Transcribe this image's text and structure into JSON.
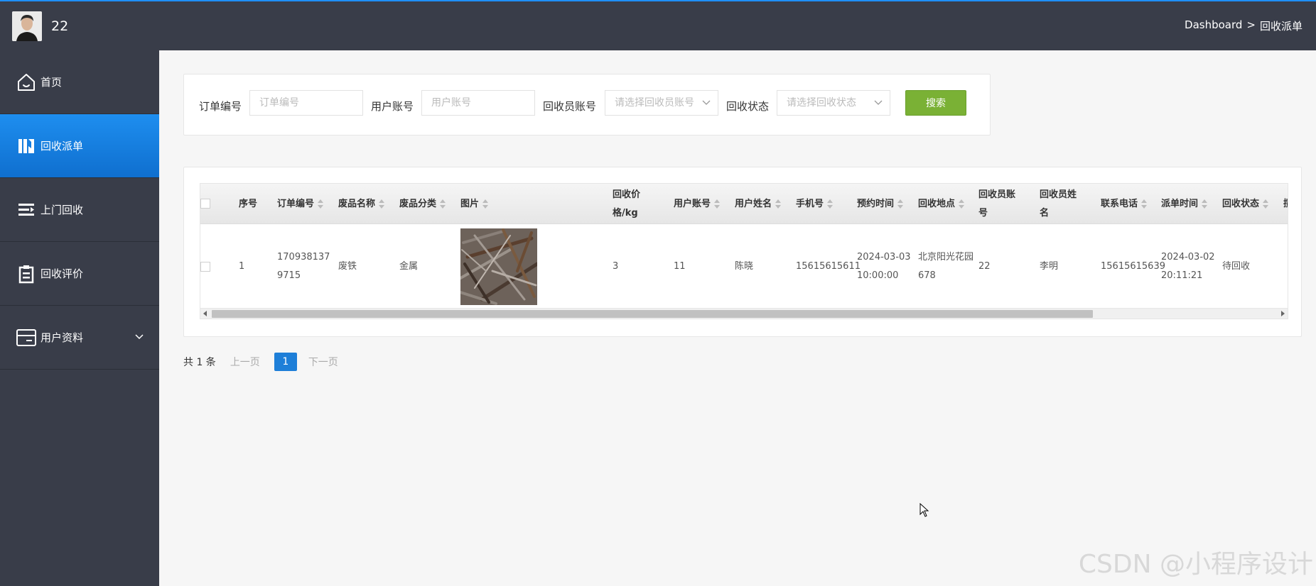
{
  "header": {
    "username": "22",
    "breadcrumb": [
      "Dashboard",
      ">",
      "回收派单"
    ]
  },
  "sidebar": {
    "items": [
      {
        "label": "首页",
        "icon": "home-icon"
      },
      {
        "label": "回收派单",
        "icon": "dispatch-icon",
        "active": true
      },
      {
        "label": "上门回收",
        "icon": "list-icon"
      },
      {
        "label": "回收评价",
        "icon": "clipboard-icon"
      },
      {
        "label": "用户资料",
        "icon": "card-icon",
        "expandable": true
      }
    ]
  },
  "search": {
    "order_label": "订单编号",
    "order_placeholder": "订单编号",
    "user_label": "用户账号",
    "user_placeholder": "用户账号",
    "collector_label": "回收员账号",
    "collector_placeholder": "请选择回收员账号",
    "status_label": "回收状态",
    "status_placeholder": "请选择回收状态",
    "button": "搜索"
  },
  "table": {
    "headers": {
      "index": "序号",
      "order_no": "订单编号",
      "waste_name": "废品名称",
      "waste_category": "废品分类",
      "image": "图片",
      "price": "回收价格/kg",
      "user_account": "用户账号",
      "user_name": "用户姓名",
      "phone": "手机号",
      "appointment_time": "预约时间",
      "address": "回收地点",
      "collector_account": "回收员账号",
      "collector_name": "回收员姓名",
      "contact_phone": "联系电话",
      "dispatch_time": "派单时间",
      "status": "回收状态",
      "extra": "揽"
    },
    "rows": [
      {
        "index": "1",
        "order_no": "1709381379715",
        "waste_name": "废铁",
        "waste_category": "金属",
        "price": "3",
        "user_account": "11",
        "user_name": "陈晓",
        "phone": "15615615611",
        "appointment_time": "2024-03-03 10:00:00",
        "address": "北京阳光花园678",
        "collector_account": "22",
        "collector_name": "李明",
        "contact_phone": "15615615639",
        "dispatch_time": "2024-03-02 20:11:21",
        "status": "待回收"
      }
    ]
  },
  "pagination": {
    "total": "共 1 条",
    "prev": "上一页",
    "current": "1",
    "next": "下一页"
  },
  "watermark": "CSDN @小程序设计",
  "colors": {
    "header_bg": "#393d49",
    "active_nav": "#1e8eef",
    "search_button": "#7ab135",
    "page_active": "#1e7fd8"
  }
}
